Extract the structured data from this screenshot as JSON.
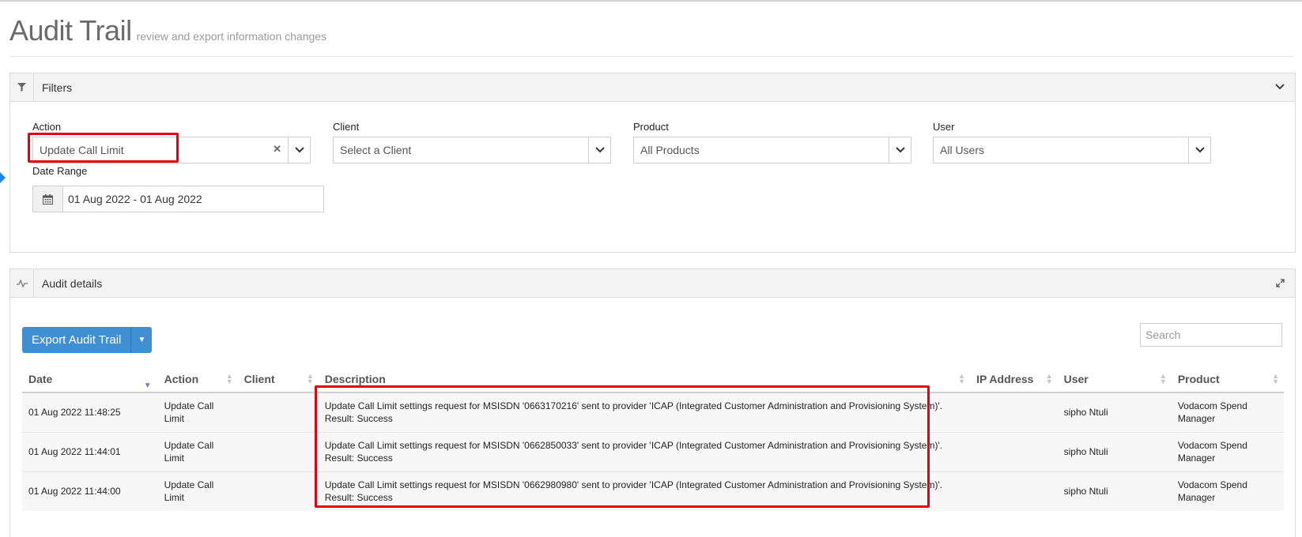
{
  "page": {
    "title": "Audit Trail",
    "subtitle": "review and export information changes"
  },
  "filters_panel": {
    "title": "Filters",
    "action": {
      "label": "Action",
      "value": "Update Call Limit"
    },
    "client": {
      "label": "Client",
      "value": "Select a Client"
    },
    "product": {
      "label": "Product",
      "value": "All Products"
    },
    "user": {
      "label": "User",
      "value": "All Users"
    },
    "date_range": {
      "label": "Date Range",
      "value": "01 Aug 2022 - 01 Aug 2022"
    }
  },
  "audit_panel": {
    "title": "Audit details",
    "export_label": "Export Audit Trail",
    "search_placeholder": "Search",
    "columns": [
      "Date",
      "Action",
      "Client",
      "Description",
      "IP Address",
      "User",
      "Product"
    ],
    "rows": [
      {
        "date": "01 Aug 2022 11:48:25",
        "action": "Update Call Limit",
        "client": "",
        "description": "Update Call Limit settings request for MSISDN '0663170216' sent to provider 'ICAP (Integrated Customer Administration and Provisioning System)'. Result: Success",
        "ip": "",
        "user": "sipho Ntuli",
        "product": "Vodacom Spend Manager"
      },
      {
        "date": "01 Aug 2022 11:44:01",
        "action": "Update Call Limit",
        "client": "",
        "description": "Update Call Limit settings request for MSISDN '0662850033' sent to provider 'ICAP (Integrated Customer Administration and Provisioning System)'. Result: Success",
        "ip": "",
        "user": "sipho Ntuli",
        "product": "Vodacom Spend Manager"
      },
      {
        "date": "01 Aug 2022 11:44:00",
        "action": "Update Call Limit",
        "client": "",
        "description": "Update Call Limit settings request for MSISDN '0662980980' sent to provider 'ICAP (Integrated Customer Administration and Provisioning System)'. Result: Success",
        "ip": "",
        "user": "sipho Ntuli",
        "product": "Vodacom Spend Manager"
      }
    ]
  },
  "colors": {
    "accent": "#3f8fd2",
    "highlight": "#e3000f",
    "panel_header": "#f3f3f3"
  }
}
